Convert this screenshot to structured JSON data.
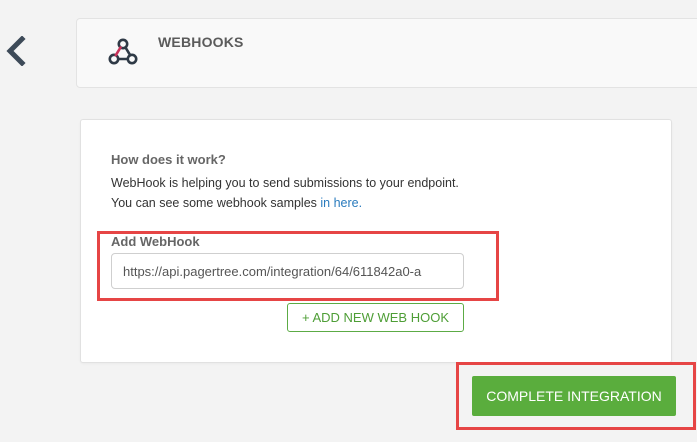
{
  "header": {
    "title": "WEBHOOKS"
  },
  "info": {
    "heading": "How does it work?",
    "line1": "WebHook is helping you to send submissions to your endpoint.",
    "line2_prefix": "You can see some webhook samples ",
    "line2_link": "in here."
  },
  "form": {
    "add_label": "Add WebHook",
    "url_value": "https://api.pagertree.com/integration/64/611842a0-a",
    "add_new_label": "+ ADD NEW WEB HOOK"
  },
  "actions": {
    "complete_label": "COMPLETE INTEGRATION"
  },
  "colors": {
    "accent_green": "#5aad3d",
    "link_blue": "#2a7bbd",
    "highlight_red": "#e64545",
    "icon_dark": "#2f3a46",
    "icon_pink": "#c8335a"
  },
  "icons": {
    "back": "chevron-left-icon",
    "integration": "webhook-icon"
  }
}
